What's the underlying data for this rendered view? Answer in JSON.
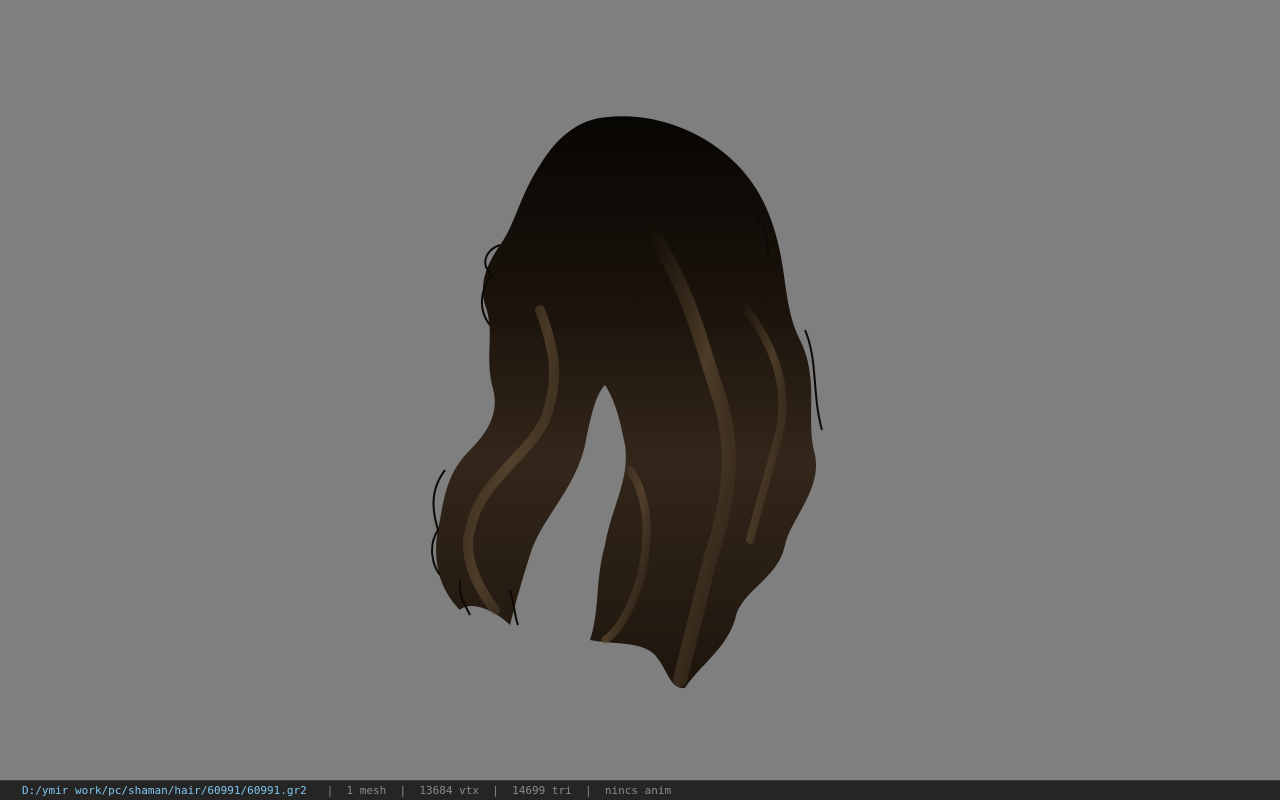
{
  "viewport": {
    "background": "#7f7f7f",
    "model": "hair-mesh"
  },
  "statusbar": {
    "path": "D:/ymir work/pc/shaman/hair/60991/60991.gr2",
    "separator": "|",
    "mesh": "1 mesh",
    "vertices": "13684 vtx",
    "triangles": "14699 tri",
    "anim": "nincs anim",
    "path_color": "#7fc4ee",
    "text_color": "#8a8a8a"
  }
}
